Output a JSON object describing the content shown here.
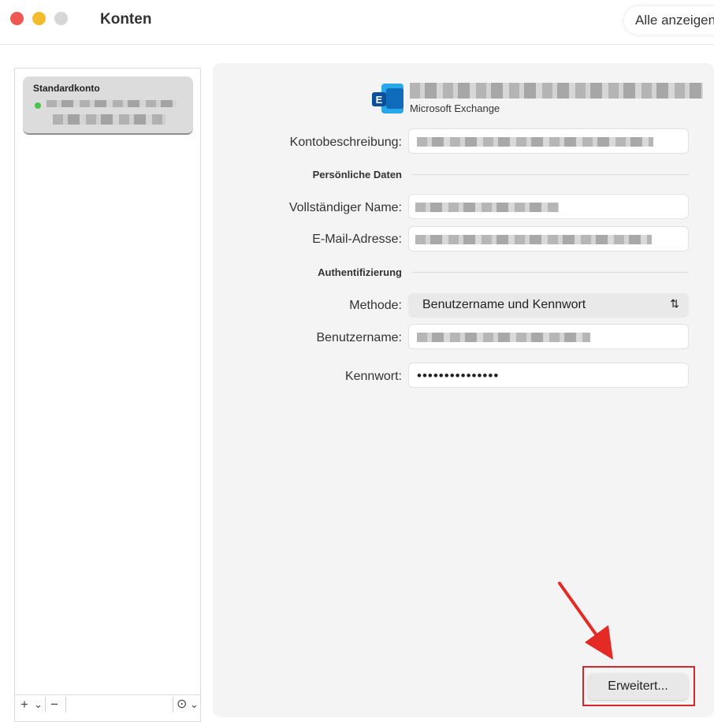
{
  "window": {
    "title": "Konten",
    "show_all_label": "Alle anzeigen"
  },
  "sidebar": {
    "account": {
      "title": "Standardkonto",
      "status": "online"
    },
    "toolbar": {
      "add_symbol": "+",
      "add_menu_symbol": "⌄",
      "remove_symbol": "−",
      "more_symbol": "⊙",
      "more_menu_symbol": "⌄"
    }
  },
  "account_detail": {
    "type_label": "Microsoft Exchange",
    "icon_letter": "E",
    "fields": {
      "description_label": "Kontobeschreibung:",
      "full_name_label": "Vollständiger Name:",
      "email_label": "E-Mail-Adresse:",
      "method_label": "Methode:",
      "method_value": "Benutzername und Kennwort",
      "username_label": "Benutzername:",
      "password_label": "Kennwort:",
      "password_value": "•••••••••••••••"
    },
    "sections": {
      "personal": "Persönliche Daten",
      "auth": "Authentifizierung"
    },
    "advanced_button": "Erweitert..."
  },
  "colors": {
    "accent_red": "#d7262b",
    "exchange_blue": "#0f6cbd",
    "status_green": "#4cc34c"
  }
}
